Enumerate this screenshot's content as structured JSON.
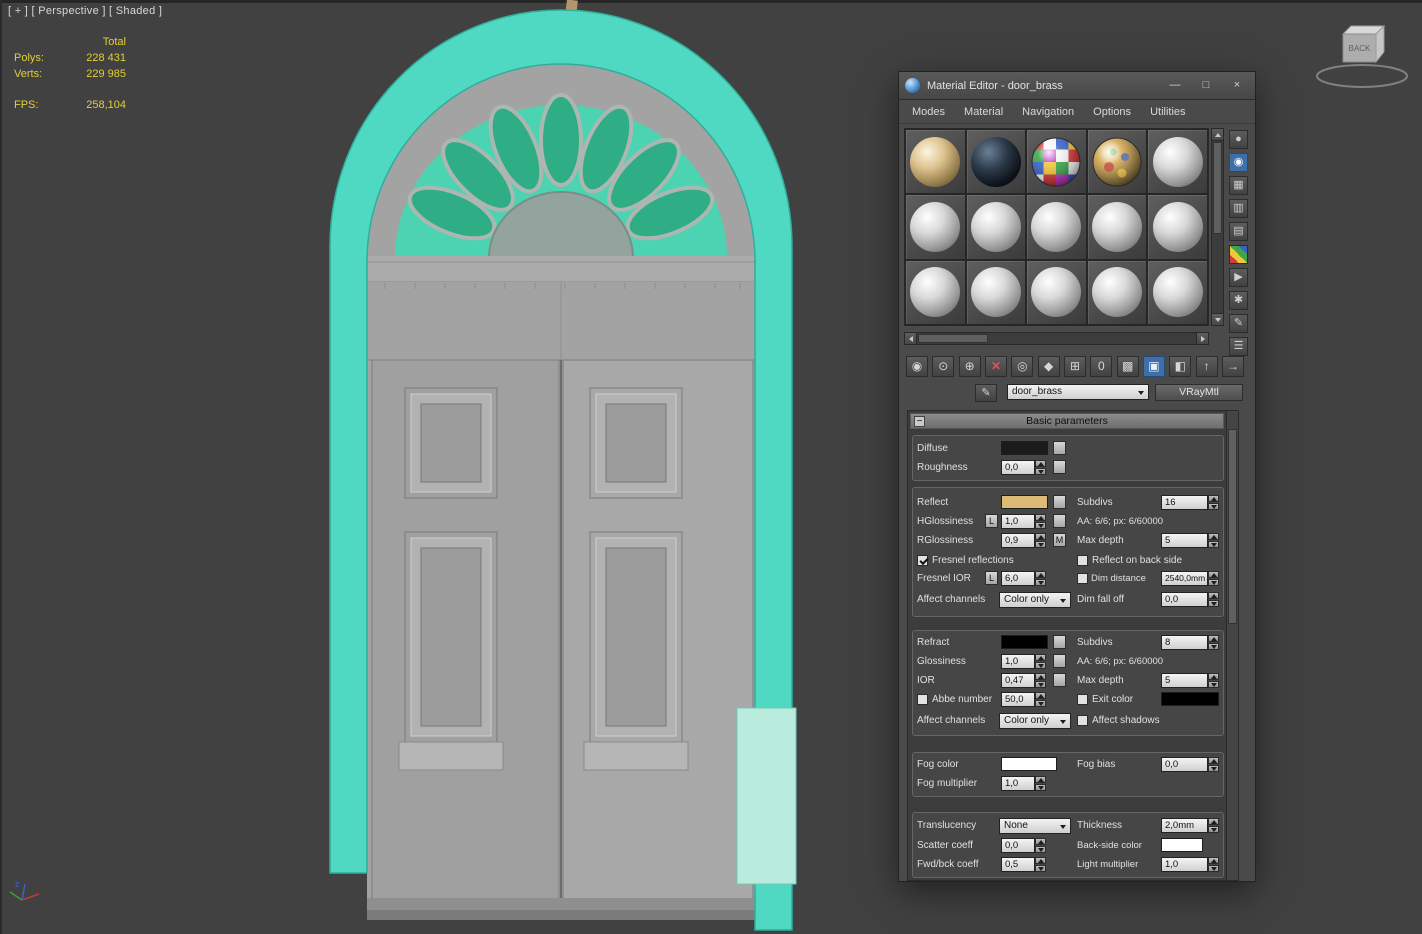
{
  "viewport": {
    "label": "[ + ] [ Perspective ] [ Shaded ]",
    "stats": {
      "total_header": "Total",
      "polys_label": "Polys:",
      "polys_value": "228 431",
      "verts_label": "Verts:",
      "verts_value": "229 985",
      "fps_label": "FPS:",
      "fps_value": "258,104"
    },
    "viewcube_face": "BACK",
    "axis_label": "z"
  },
  "colors": {
    "frame_teal": "#4fd8c2",
    "glass_green": "#2fae85",
    "diffuse_swatch": "#1b1b1b",
    "reflect_swatch": "#ddbb76",
    "refract_swatch": "#000000",
    "exit_color_swatch": "#000000",
    "fog_color_swatch": "#ffffff",
    "backside_color_swatch": "#ffffff",
    "active_tool_blue": "#3f6fa8"
  },
  "me": {
    "title": "Material Editor - door_brass",
    "buttons": {
      "minimize": "—",
      "maximize": "□",
      "close": "×"
    },
    "menus": [
      "Modes",
      "Material",
      "Navigation",
      "Options",
      "Utilities"
    ],
    "sample_slots": [
      "brass",
      "dark-glass",
      "multicolor-checker",
      "brass-reflective",
      "gray",
      "gray",
      "gray",
      "gray",
      "gray",
      "gray",
      "gray",
      "gray",
      "gray",
      "gray",
      "gray"
    ],
    "side_tools": [
      {
        "name": "sample-type-sphere-icon",
        "glyph": "●"
      },
      {
        "name": "magnifier-icon",
        "glyph": "◉"
      },
      {
        "name": "background-checker-icon",
        "glyph": "▦"
      },
      {
        "name": "sample-uv-tiling-icon",
        "glyph": "▥"
      },
      {
        "name": "video-color-check-icon",
        "glyph": "▤"
      },
      {
        "name": "color-palette-icon",
        "glyph": ""
      },
      {
        "name": "generate-preview-icon",
        "glyph": "▶"
      },
      {
        "name": "options-icon",
        "glyph": "✱"
      },
      {
        "name": "select-by-material-icon",
        "glyph": "✎"
      },
      {
        "name": "material-map-navigator-icon",
        "glyph": "☰"
      }
    ],
    "toolbar": [
      {
        "name": "get-material-icon",
        "glyph": "◉"
      },
      {
        "name": "put-material-to-scene-icon",
        "glyph": "⊙"
      },
      {
        "name": "assign-material-to-selection-icon",
        "glyph": "⊕"
      },
      {
        "name": "reset-map-icon",
        "glyph": "✕"
      },
      {
        "name": "make-material-copy-icon",
        "glyph": "◎"
      },
      {
        "name": "make-unique-icon",
        "glyph": "◆"
      },
      {
        "name": "put-to-library-icon",
        "glyph": "⊞"
      },
      {
        "name": "material-id-channel-icon",
        "glyph": "0"
      },
      {
        "name": "show-background-icon",
        "glyph": "▩"
      },
      {
        "name": "show-shaded-material-in-viewport-icon",
        "glyph": "▣"
      },
      {
        "name": "show-end-result-icon",
        "glyph": "◧"
      },
      {
        "name": "go-to-parent-icon",
        "glyph": "↑"
      },
      {
        "name": "go-forward-to-sibling-icon",
        "glyph": "→"
      }
    ],
    "picker": {
      "name_value": "door_brass",
      "type_button": "VRayMtl"
    },
    "rollout": {
      "collapse": "−",
      "title": "Basic parameters"
    },
    "params": {
      "diffuse_label": "Diffuse",
      "roughness_label": "Roughness",
      "roughness_value": "0,0",
      "reflect_label": "Reflect",
      "subdivs_reflect_label": "Subdivs",
      "subdivs_reflect_value": "16",
      "hglossiness_label": "HGlossiness",
      "lock_l": "L",
      "hglossiness_value": "1,0",
      "aa_reflect": "AA: 6/6; px: 6/60000",
      "rglossiness_label": "RGlossiness",
      "rglossiness_value": "0,9",
      "lock_m": "M",
      "max_depth_reflect_label": "Max depth",
      "max_depth_reflect_value": "5",
      "fresnel_reflections_label": "Fresnel reflections",
      "reflect_back_side_label": "Reflect on back side",
      "fresnel_ior_label": "Fresnel IOR",
      "fresnel_ior_value": "6,0",
      "dim_distance_label": "Dim distance",
      "dim_distance_value": "2540,0mm",
      "affect_channels_label": "Affect channels",
      "affect_channels_reflect_value": "Color only",
      "dim_fall_off_label": "Dim fall off",
      "dim_fall_off_value": "0,0",
      "refract_label": "Refract",
      "subdivs_refract_label": "Subdivs",
      "subdivs_refract_value": "8",
      "glossiness_label": "Glossiness",
      "glossiness_value": "1,0",
      "aa_refract": "AA: 6/6; px: 6/60000",
      "ior_label": "IOR",
      "ior_value": "0,47",
      "max_depth_refract_label": "Max depth",
      "max_depth_refract_value": "5",
      "abbe_number_label": "Abbe number",
      "abbe_number_value": "50,0",
      "exit_color_label": "Exit color",
      "affect_channels_refract_value": "Color only",
      "affect_shadows_label": "Affect shadows",
      "fog_color_label": "Fog color",
      "fog_bias_label": "Fog bias",
      "fog_bias_value": "0,0",
      "fog_multiplier_label": "Fog multiplier",
      "fog_multiplier_value": "1,0",
      "translucency_label": "Translucency",
      "translucency_value": "None",
      "thickness_label": "Thickness",
      "thickness_value": "2,0mm",
      "scatter_coeff_label": "Scatter coeff",
      "scatter_coeff_value": "0,0",
      "back_side_color_label": "Back-side color",
      "fwd_bck_coeff_label": "Fwd/bck coeff",
      "fwd_bck_coeff_value": "0,5",
      "light_multiplier_label": "Light multiplier",
      "light_multiplier_value": "1,0"
    }
  }
}
